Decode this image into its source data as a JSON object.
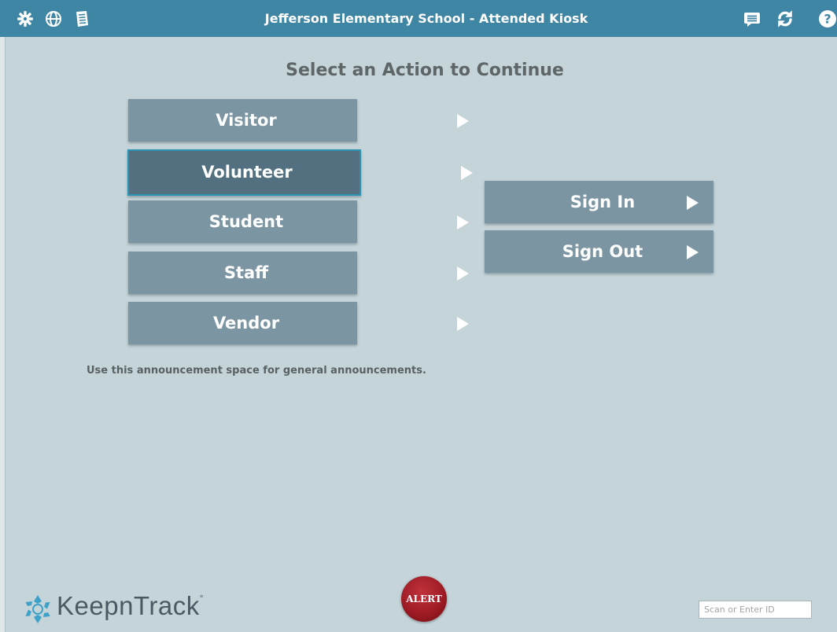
{
  "header": {
    "title": "Jefferson Elementary School - Attended Kiosk",
    "background": "#3f86a5",
    "left_icons": [
      "settings-icon",
      "globe-icon",
      "document-list-icon"
    ],
    "right_icons": [
      "message-icon",
      "refresh-icon",
      "help-icon"
    ]
  },
  "main": {
    "heading": "Select an Action to Continue",
    "categories": [
      {
        "label": "Visitor",
        "selected": false
      },
      {
        "label": "Volunteer",
        "selected": true
      },
      {
        "label": "Student",
        "selected": false
      },
      {
        "label": "Staff",
        "selected": false
      },
      {
        "label": "Vendor",
        "selected": false
      }
    ],
    "actions": [
      {
        "label": "Sign In"
      },
      {
        "label": "Sign Out"
      }
    ],
    "announcement": "Use this announcement space for general announcements."
  },
  "footer": {
    "logo_text": "KeepnTrack",
    "logo_mark": "°",
    "alert_label": "ALERT",
    "scan_placeholder": "Scan or Enter ID",
    "scan_value": ""
  },
  "colors": {
    "background": "#c4d4d8",
    "button": "#7c95a2",
    "button_selected": "#52707f",
    "selected_border": "#2b93b3",
    "alert": "#9f1c25"
  }
}
